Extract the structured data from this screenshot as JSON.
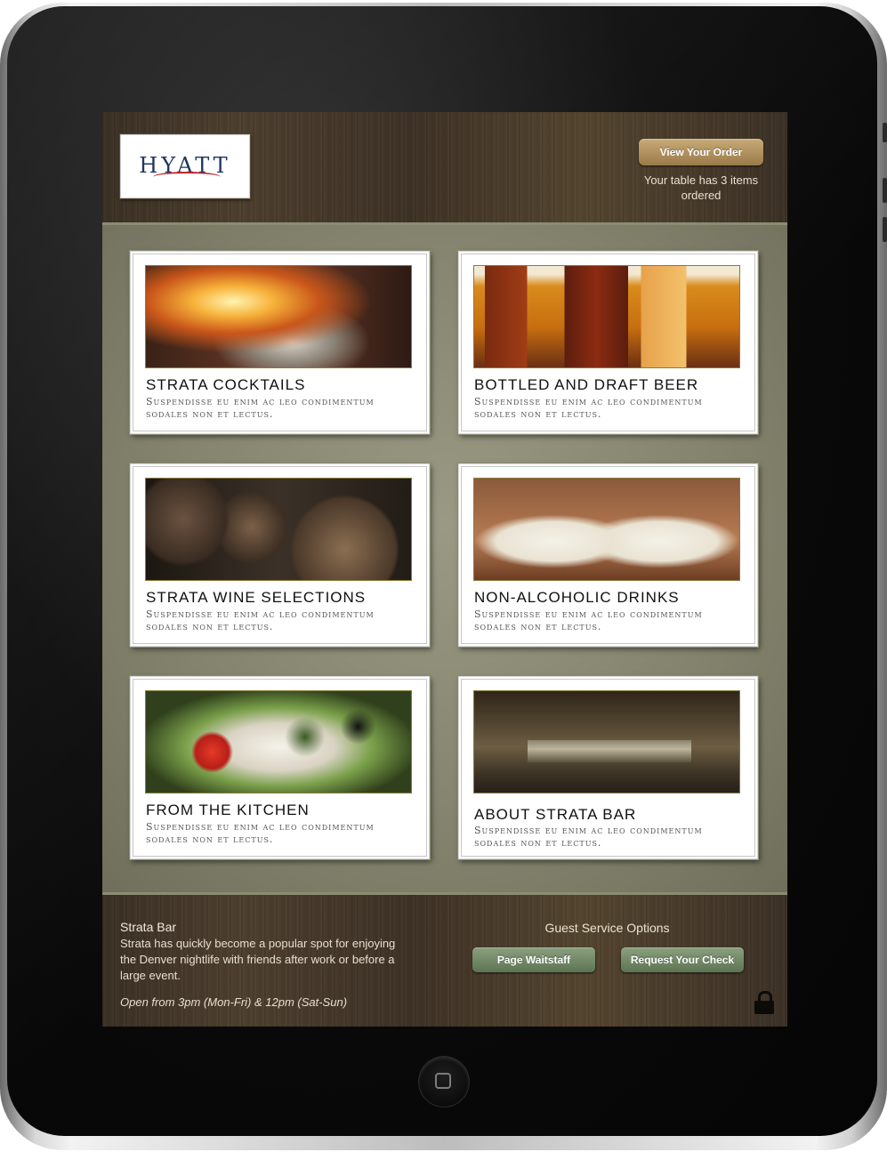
{
  "header": {
    "logo_text": "HYATT",
    "view_order_label": "View Your Order",
    "order_status": "Your table has 3 items ordered"
  },
  "menu": {
    "categories": [
      {
        "title": "STRATA COCKTAILS",
        "description": "Suspendisse eu enim ac leo condimentum sodales non et lectus."
      },
      {
        "title": "BOTTLED AND DRAFT BEER",
        "description": "Suspendisse eu enim ac leo condimentum sodales non et lectus."
      },
      {
        "title": "STRATA WINE SELECTIONS",
        "description": "Suspendisse eu enim ac leo condimentum sodales non et lectus."
      },
      {
        "title": "NON-ALCOHOLIC DRINKS",
        "description": "Suspendisse eu enim ac leo condimentum sodales non et lectus."
      },
      {
        "title": "FROM THE KITCHEN",
        "description": "Suspendisse eu enim ac leo condimentum sodales non et lectus."
      },
      {
        "title": "ABOUT STRATA BAR",
        "description": "Suspendisse eu enim ac leo condimentum sodales non et lectus."
      }
    ]
  },
  "footer": {
    "venue_name": "Strata Bar",
    "venue_description": "Strata has quickly become a popular spot for enjoying the Denver nightlife with friends after work or before a large event.",
    "hours": "Open from 3pm (Mon-Fri) & 12pm (Sat-Sun)",
    "guest_service_title": "Guest Service Options",
    "page_waitstaff_label": "Page Waitstaff",
    "request_check_label": "Request Your Check"
  },
  "colors": {
    "brand_blue": "#1f3563",
    "brand_red": "#c0242c",
    "gold_button": "#b0905e",
    "green_button": "#6f8763",
    "wood_brown": "#3e3226"
  },
  "icons": [
    "lock-icon",
    "home-button-icon"
  ]
}
